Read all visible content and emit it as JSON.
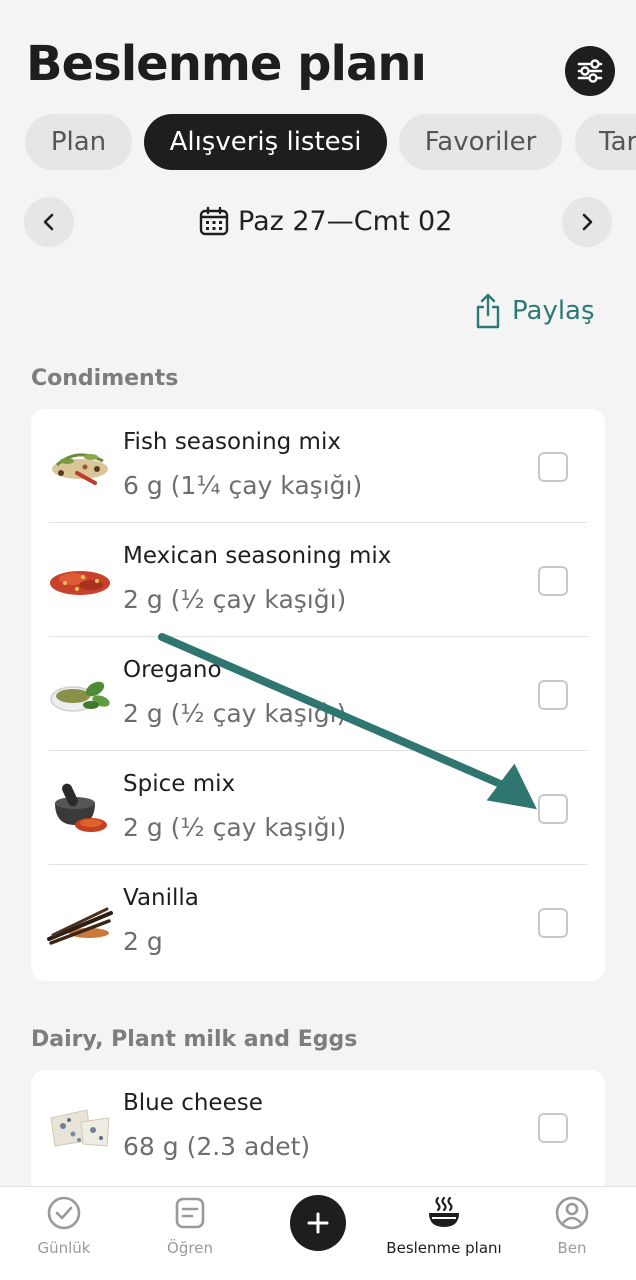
{
  "header": {
    "title": "Beslenme planı"
  },
  "tabs": [
    {
      "label": "Plan",
      "active": false
    },
    {
      "label": "Alışveriş listesi",
      "active": true
    },
    {
      "label": "Favoriler",
      "active": false
    },
    {
      "label": "Tar",
      "active": false
    }
  ],
  "week": {
    "label": "Paz 27—Cmt 02"
  },
  "share": {
    "label": "Paylaş"
  },
  "sections": [
    {
      "title": "Condiments",
      "items": [
        {
          "name": "Fish seasoning mix",
          "qty": "6 g (1¼ çay kaşığı)",
          "checked": false
        },
        {
          "name": "Mexican seasoning mix",
          "qty": "2 g (½ çay kaşığı)",
          "checked": false
        },
        {
          "name": "Oregano",
          "qty": "2 g (½ çay kaşığı)",
          "checked": false
        },
        {
          "name": "Spice mix",
          "qty": "2 g (½ çay kaşığı)",
          "checked": false
        },
        {
          "name": "Vanilla",
          "qty": "2 g",
          "checked": false
        }
      ]
    },
    {
      "title": "Dairy, Plant milk and Eggs",
      "items": [
        {
          "name": "Blue cheese",
          "qty": "68 g (2.3 adet)",
          "checked": false
        }
      ]
    }
  ],
  "bottom_nav": [
    {
      "label": "Günlük",
      "icon": "check-circle-icon",
      "active": false
    },
    {
      "label": "Öğren",
      "icon": "note-icon",
      "active": false
    },
    {
      "label": "Beslenme planı",
      "icon": "bowl-icon",
      "active": true
    },
    {
      "label": "Ben",
      "icon": "profile-icon",
      "active": false
    }
  ],
  "colors": {
    "accent": "#2c7a75",
    "dark": "#1e1e1e",
    "background": "#f4f4f4"
  }
}
